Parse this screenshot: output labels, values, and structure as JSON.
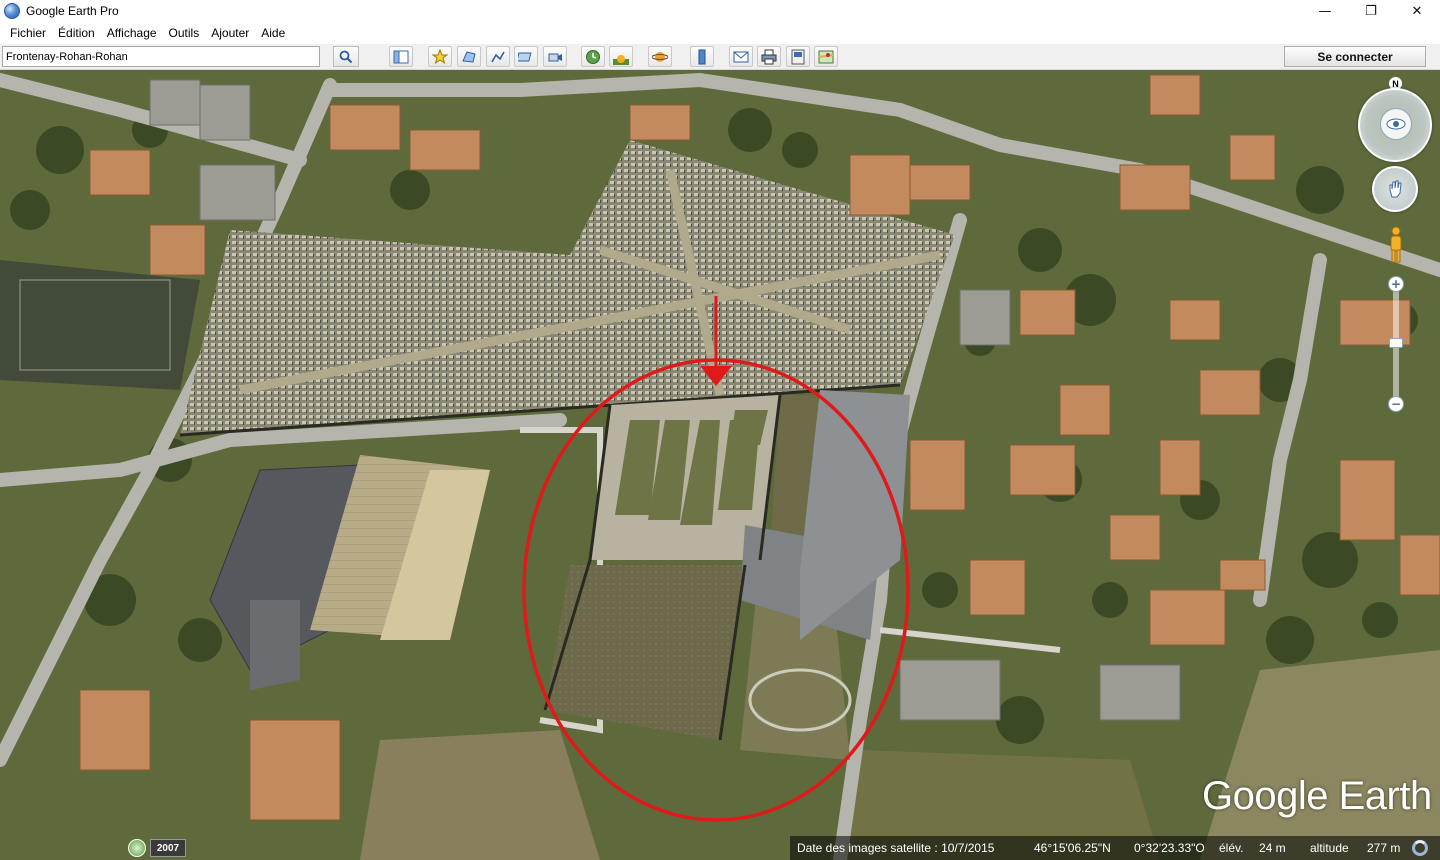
{
  "window": {
    "title": "Google Earth Pro",
    "controls": {
      "minimize": "—",
      "restore": "❐",
      "close": "✕"
    }
  },
  "menu": {
    "items": [
      "Fichier",
      "Édition",
      "Affichage",
      "Outils",
      "Ajouter",
      "Aide"
    ]
  },
  "toolbar": {
    "search_value": "Frontenay-Rohan-Rohan",
    "connect_label": "Se connecter",
    "buttons": [
      "sidebar-toggle-icon",
      "placemark-icon",
      "polygon-icon",
      "path-icon",
      "image-overlay-icon",
      "record-tour-icon",
      "historical-imagery-icon",
      "sunlight-icon",
      "planets-icon",
      "ruler-icon",
      "email-icon",
      "print-icon",
      "save-image-icon",
      "maps-icon"
    ]
  },
  "map": {
    "annotation_color": "#e0191b",
    "nav": {
      "north_label": "N",
      "zoom_in": "+",
      "zoom_out": "−"
    },
    "brand": "Google Earth"
  },
  "status": {
    "year": "2007",
    "imagery_date": "Date des images satellite : 10/7/2015",
    "lat": "46°15'06.25\"N",
    "lon": "0°32'23.33\"O",
    "elev_label": "élév.",
    "elev_value": "24 m",
    "alt_label": "altitude",
    "alt_value": "277 m"
  }
}
